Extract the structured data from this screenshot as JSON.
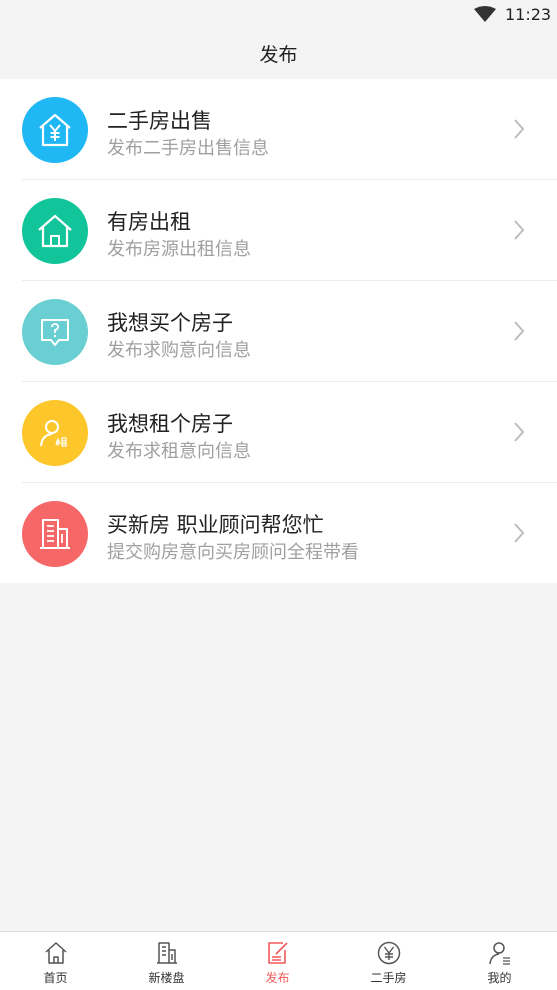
{
  "status_bar": {
    "time": "11:23"
  },
  "header": {
    "title": "发布"
  },
  "colors": {
    "secondhand_sale": "#20b7f5",
    "rent_out": "#12c49a",
    "want_buy": "#6acfd2",
    "want_rent": "#fdc72b",
    "new_house": "#f66767",
    "active_tab": "#f25a5a"
  },
  "items": [
    {
      "title": "二手房出售",
      "subtitle": "发布二手房出售信息",
      "icon": "house-yen-icon"
    },
    {
      "title": "有房出租",
      "subtitle": "发布房源出租信息",
      "icon": "house-icon"
    },
    {
      "title": "我想买个房子",
      "subtitle": "发布求购意向信息",
      "icon": "question-chat-icon"
    },
    {
      "title": "我想租个房子",
      "subtitle": "发布求租意向信息",
      "icon": "person-rent-icon"
    },
    {
      "title": "买新房 职业顾问帮您忙",
      "subtitle": "提交购房意向买房顾问全程带看",
      "icon": "building-icon"
    }
  ],
  "tabbar": {
    "tabs": [
      {
        "label": "首页",
        "icon": "home-icon",
        "active": false
      },
      {
        "label": "新楼盘",
        "icon": "building-icon",
        "active": false
      },
      {
        "label": "发布",
        "icon": "edit-icon",
        "active": true
      },
      {
        "label": "二手房",
        "icon": "yen-circle-icon",
        "active": false
      },
      {
        "label": "我的",
        "icon": "user-icon",
        "active": false
      }
    ]
  }
}
